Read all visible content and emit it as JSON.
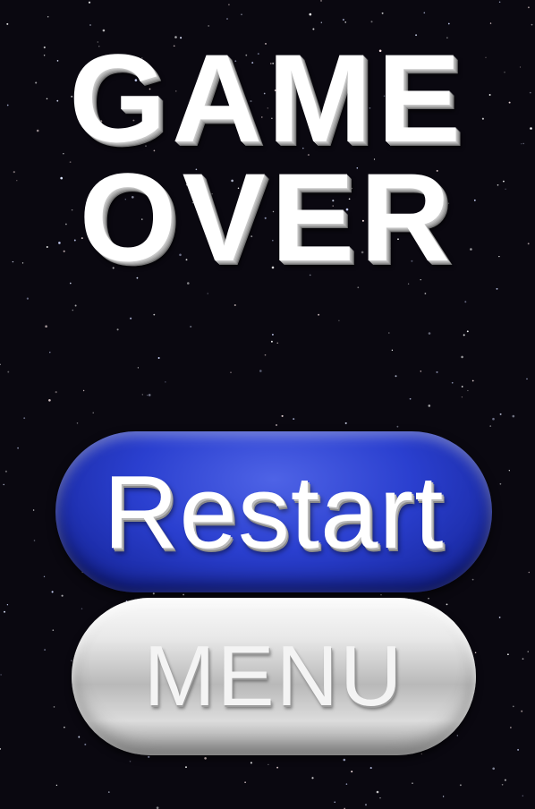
{
  "title": {
    "line1": "GAME",
    "line2": "OVER"
  },
  "buttons": {
    "restart_label": "Restart",
    "menu_label": "MENU"
  },
  "colors": {
    "background": "#0a0810",
    "restart": "#2a3fcf",
    "menu": "#d9d9d9",
    "title_text": "#ffffff"
  }
}
